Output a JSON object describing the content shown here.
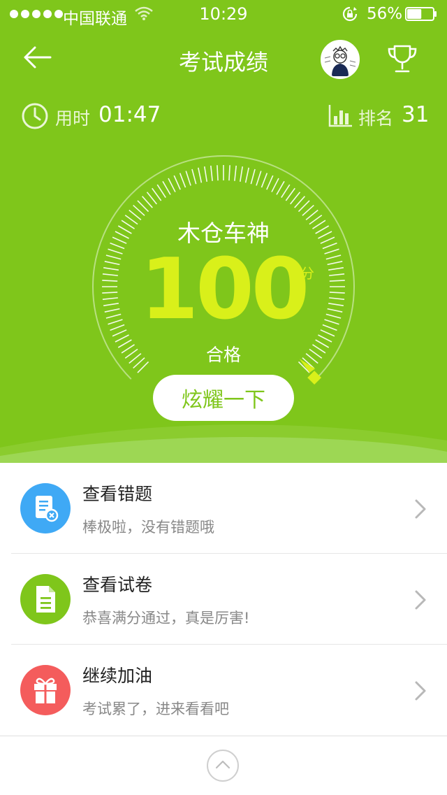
{
  "status_bar": {
    "carrier": "中国联通",
    "time": "10:29",
    "battery_percent": "56%",
    "battery_level": 0.56,
    "signal_icon": "signal-dots-icon",
    "wifi_icon": "wifi-icon",
    "lock_icon": "rotation-lock-icon"
  },
  "nav": {
    "title": "考试成绩",
    "back_icon": "arrow-left-icon",
    "avatar_icon": "avatar",
    "trophy_icon": "trophy-icon"
  },
  "stats": {
    "time_label": "用时",
    "time_value": "01:47",
    "rank_label": "排名",
    "rank_value": "31",
    "clock_icon": "clock-icon",
    "rank_icon": "bar-chart-icon"
  },
  "score": {
    "title": "木仓车神",
    "value": "100",
    "unit": "分",
    "result": "合格",
    "gauge_fraction": 1.0
  },
  "share_button": "炫耀一下",
  "list": [
    {
      "title": "查看错题",
      "subtitle": "棒极啦，没有错题哦",
      "icon": "wrong-questions-icon",
      "color": "#3fa9f5"
    },
    {
      "title": "查看试卷",
      "subtitle": "恭喜满分通过，真是厉害!",
      "icon": "document-icon",
      "color": "#7fc61b"
    },
    {
      "title": "继续加油",
      "subtitle": "考试累了，进来看看吧",
      "icon": "gift-icon",
      "color": "#f45c5c"
    }
  ],
  "bottom_bar": {
    "up_icon": "chevron-up-icon"
  },
  "colors": {
    "primary_green": "#7fc61b",
    "score_yellow": "#d9f01a",
    "white": "#ffffff"
  }
}
